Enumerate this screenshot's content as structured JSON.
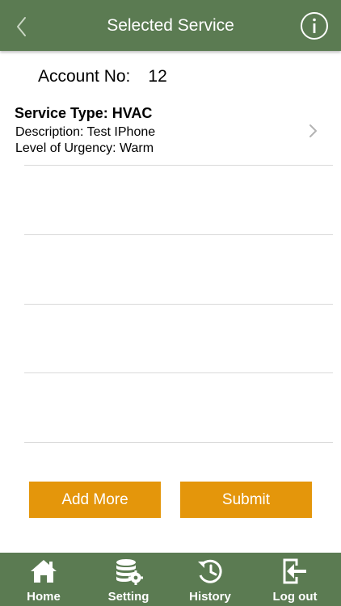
{
  "nav": {
    "title": "Selected Service",
    "back_icon": "chevron-left-icon",
    "info_icon": "info-icon"
  },
  "account": {
    "label": "Account No:",
    "value": "12"
  },
  "service": {
    "type": "Service Type: HVAC",
    "description": "Description: Test IPhone",
    "urgency": "Level of Urgency: Warm"
  },
  "buttons": {
    "add_more": "Add More",
    "submit": "Submit"
  },
  "tabbar": {
    "home": "Home",
    "setting": "Setting",
    "history": "History",
    "logout": "Log out"
  },
  "colors": {
    "nav_bg": "#5b7b52",
    "button_bg": "#e4960b",
    "separator": "#d9d9d9"
  }
}
